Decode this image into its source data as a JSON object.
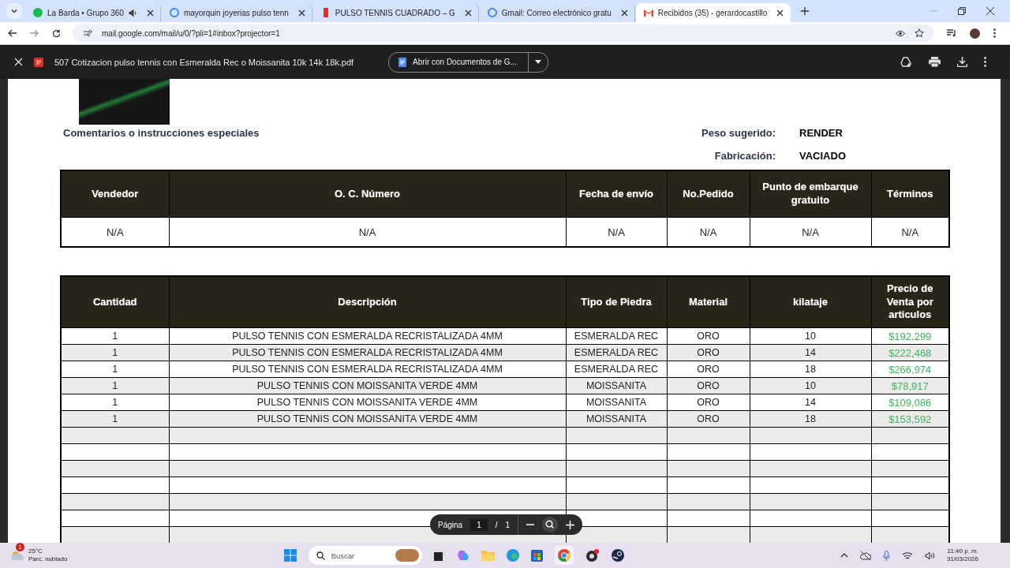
{
  "browser": {
    "tabs": [
      {
        "title": "La Barda • Grupo 360",
        "kind": "music",
        "audio": true,
        "selected": false
      },
      {
        "title": "mayorquin joyerias pulso tenn",
        "kind": "google",
        "audio": false,
        "selected": false
      },
      {
        "title": "PULSO TENNIS CUADRADO – G",
        "kind": "bar",
        "audio": false,
        "selected": false
      },
      {
        "title": "Gmail: Correo electrónico gratu",
        "kind": "google",
        "audio": false,
        "selected": false
      },
      {
        "title": "Recibidos (35) - gerardocastillo",
        "kind": "mail",
        "audio": false,
        "selected": true
      }
    ],
    "url": "mail.google.com/mail/u/0/?pli=1#inbox?projector=1"
  },
  "pdf_viewer": {
    "filename": "507 Cotizacion pulso tennis con Esmeralda Rec o Moissanita 10k 14k 18k.pdf",
    "open_with": "Abrir con Documentos de G..."
  },
  "document": {
    "comments_label": "Comentarios o instrucciones especiales",
    "fields": [
      {
        "label": "Peso sugerido:",
        "value": "RENDER"
      },
      {
        "label": "Fabricación:",
        "value": "VACIADO"
      }
    ],
    "order_table": {
      "columns": [
        "Vendedor",
        "O. C. Número",
        "Fecha de envío",
        "No.Pedido",
        "Punto de embarque gratuito",
        "Términos"
      ],
      "rows": [
        [
          "N/A",
          "N/A",
          "N/A",
          "N/A",
          "N/A",
          "N/A"
        ]
      ]
    },
    "items_table": {
      "columns": [
        "Cantidad",
        "Descripción",
        "Tipo de Piedra",
        "Material",
        "kilataje",
        "Precio de Venta por articulos"
      ],
      "rows": [
        [
          "1",
          "PULSO TENNIS CON ESMERALDA RECRISTALIZADA 4MM",
          "ESMERALDA REC",
          "ORO",
          "10",
          "$192,299"
        ],
        [
          "1",
          "PULSO TENNIS CON ESMERALDA RECRISTALIZADA 4MM",
          "ESMERALDA REC",
          "ORO",
          "14",
          "$222,468"
        ],
        [
          "1",
          "PULSO TENNIS CON ESMERALDA RECRISTALIZADA 4MM",
          "ESMERALDA REC",
          "ORO",
          "18",
          "$266,974"
        ],
        [
          "1",
          "PULSO TENNIS CON MOISSANITA VERDE 4MM",
          "MOISSANITA",
          "ORO",
          "10",
          "$78,917"
        ],
        [
          "1",
          "PULSO TENNIS CON MOISSANITA VERDE 4MM",
          "MOISSANITA",
          "ORO",
          "14",
          "$109,086"
        ],
        [
          "1",
          "PULSO TENNIS CON MOISSANITA VERDE 4MM",
          "MOISSANITA",
          "ORO",
          "18",
          "$153,592"
        ]
      ]
    }
  },
  "page_controls": {
    "label": "Página",
    "current": "1",
    "separator": "/",
    "total": "1"
  },
  "taskbar": {
    "weather": {
      "badge": "1",
      "temperature": "25°C",
      "condition": "Parc. nublado"
    },
    "search_placeholder": "Buscar",
    "time": "11:40 p. m.",
    "date": "31/03/2026"
  }
}
